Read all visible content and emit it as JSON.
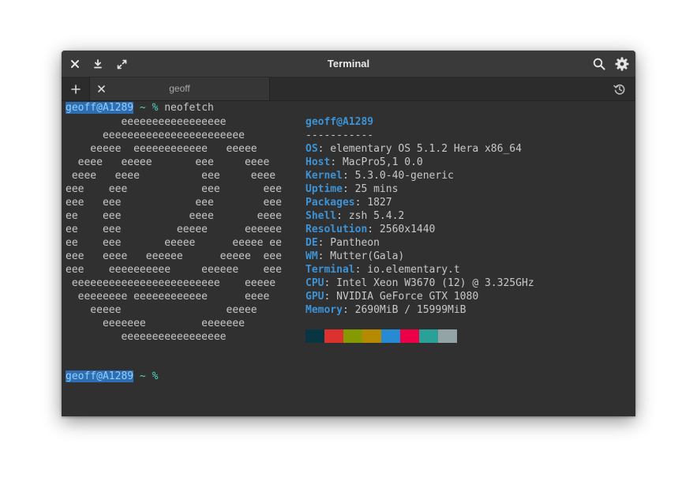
{
  "window": {
    "title": "Terminal"
  },
  "tabs": [
    {
      "label": "geoff"
    }
  ],
  "terminal": {
    "prompt_user": "geoff@A1289",
    "prompt_sep": " ~ % ",
    "command": "neofetch",
    "prompt2_user": "geoff@A1289",
    "prompt2_sep": " ~ %",
    "logo": "         eeeeeeeeeeeeeeeee\n      eeeeeeeeeeeeeeeeeeeeeee\n    eeeee  eeeeeeeeeeee   eeeee\n  eeee   eeeee       eee     eeee\n eeee   eeee          eee     eeee\neee    eee            eee       eee\neee   eee            eee        eee\nee    eee           eeee       eeee\nee    eee         eeeee      eeeeee\nee    eee       eeeee      eeeee ee\neee   eeee   eeeeee      eeeee  eee\neee    eeeeeeeeee     eeeeee    eee\n eeeeeeeeeeeeeeeeeeeeeeee    eeeee\n  eeeeeeee eeeeeeeeeeee      eeee\n    eeeee                 eeeee\n      eeeeeee         eeeeeee\n         eeeeeeeeeeeeeeeee",
    "userhost": "geoff@A1289",
    "separator": "-----------",
    "info": [
      {
        "key": "OS",
        "value": ": elementary OS 5.1.2 Hera x86_64"
      },
      {
        "key": "Host",
        "value": ": MacPro5,1 0.0"
      },
      {
        "key": "Kernel",
        "value": ": 5.3.0-40-generic"
      },
      {
        "key": "Uptime",
        "value": ": 25 mins"
      },
      {
        "key": "Packages",
        "value": ": 1827"
      },
      {
        "key": "Shell",
        "value": ": zsh 5.4.2"
      },
      {
        "key": "Resolution",
        "value": ": 2560x1440"
      },
      {
        "key": "DE",
        "value": ": Pantheon"
      },
      {
        "key": "WM",
        "value": ": Mutter(Gala)"
      },
      {
        "key": "Terminal",
        "value": ": io.elementary.t"
      },
      {
        "key": "CPU",
        "value": ": Intel Xeon W3670 (12) @ 3.325GHz"
      },
      {
        "key": "GPU",
        "value": ": NVIDIA GeForce GTX 1080"
      },
      {
        "key": "Memory",
        "value": ": 2690MiB / 15999MiB"
      }
    ],
    "colors": [
      "#073642",
      "#dc322f",
      "#859900",
      "#b58900",
      "#268bd2",
      "#ec0048",
      "#2aa198",
      "#94a3a5"
    ]
  },
  "icons": {
    "close": "close-icon",
    "download": "download-icon",
    "fullscreen": "fullscreen-icon",
    "search": "search-icon",
    "settings": "gear-icon",
    "new_tab": "plus-icon",
    "tab_close": "close-icon",
    "history": "history-icon"
  }
}
